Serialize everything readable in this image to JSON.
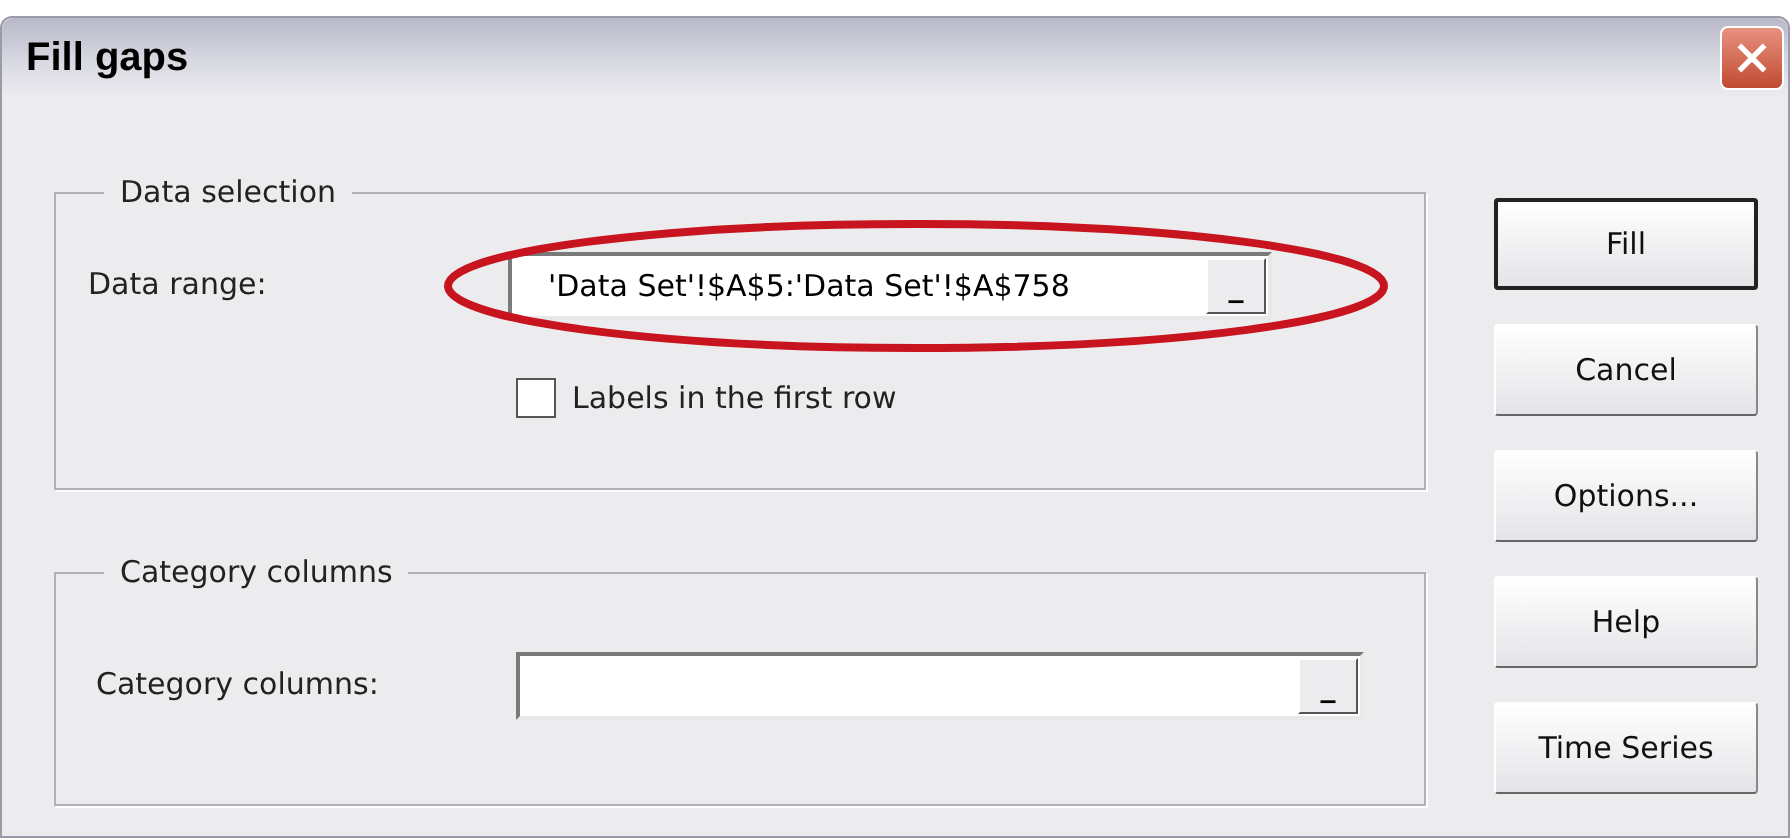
{
  "window": {
    "title": "Fill gaps"
  },
  "data_selection": {
    "legend": "Data selection",
    "data_range": {
      "label": "Data range:",
      "value": "'Data Set'!$A$5:'Data Set'!$A$758",
      "picker": "_"
    },
    "labels_checkbox": {
      "label": "Labels in the first row",
      "checked": false
    }
  },
  "category_columns": {
    "legend": "Category columns",
    "field": {
      "label": "Category columns:",
      "picker": "_"
    }
  },
  "buttons": [
    {
      "label": "Fill",
      "default": true
    },
    {
      "label": "Cancel",
      "default": false
    },
    {
      "label": "Options...",
      "default": false
    },
    {
      "label": "Help",
      "default": false
    },
    {
      "label": "Time Series",
      "default": false
    }
  ]
}
